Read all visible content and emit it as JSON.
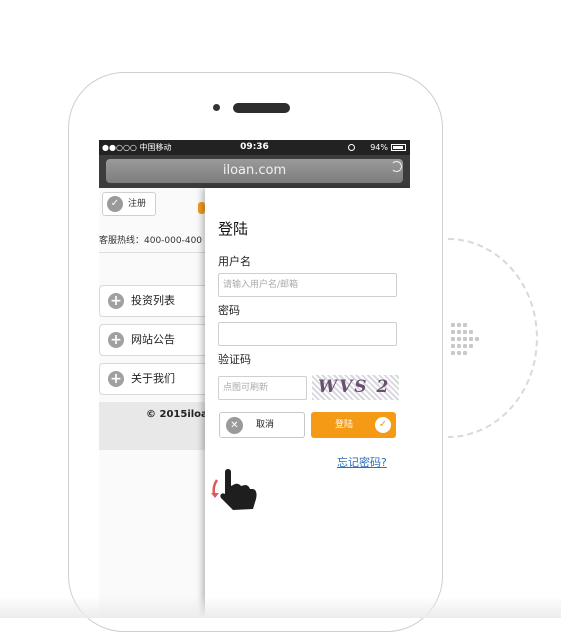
{
  "status_bar": {
    "carrier": "●●○○○ 中国移动",
    "time": "09:36",
    "battery": "94%"
  },
  "browser": {
    "url": "iloan.com"
  },
  "site": {
    "register_label": "注册",
    "hotline": "客服热线：400-000-400",
    "menu": [
      {
        "label": "投资列表"
      },
      {
        "label": "网站公告"
      },
      {
        "label": "关于我们"
      }
    ],
    "footer": "© 2015iloa"
  },
  "login": {
    "title": "登陆",
    "username_label": "用户名",
    "username_placeholder": "请输入用户名/邮箱",
    "password_label": "密码",
    "captcha_label": "验证码",
    "captcha_placeholder": "点图可刷新",
    "captcha_text": "WVS 2",
    "cancel_label": "取消",
    "login_label": "登陆",
    "forgot_label": "忘记密码?"
  },
  "colors": {
    "accent": "#f49a14",
    "link": "#2c6fb8",
    "status_bg": "#222222",
    "url_bar": "#3c3c3c"
  }
}
